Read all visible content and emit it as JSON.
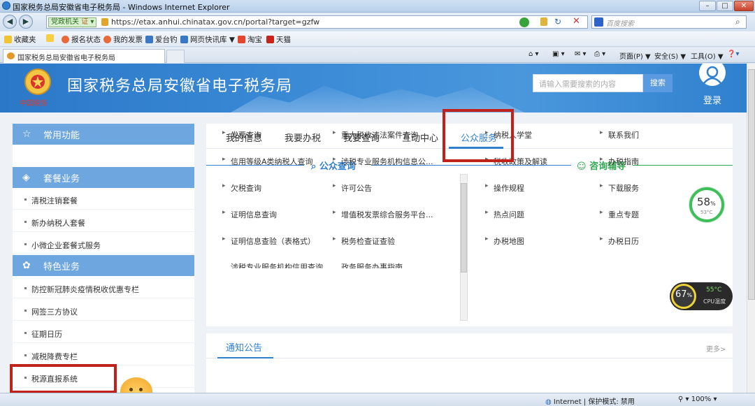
{
  "window": {
    "title": "国家税务总局安徽省电子税务局 - Windows Internet Explorer"
  },
  "addressbar": {
    "site_tag": "党政机关",
    "cert_tag": "证",
    "url": "https://etax.anhui.chinatax.gov.cn/portal?target=gzfw",
    "search_placeholder": "百度搜索"
  },
  "favorites": {
    "label": "收藏夹",
    "items": [
      "报名状态",
      "我的发票",
      "爱台钓",
      "网页快讯库 ▼",
      "淘宝",
      "天猫"
    ]
  },
  "tabbar": {
    "tab_title": "国家税务总局安徽省电子税务局",
    "tools": [
      "页面(P) ▼",
      "安全(S) ▼",
      "工具(O) ▼"
    ]
  },
  "header": {
    "emblem_text": "中国税务",
    "site_title": "国家税务总局安徽省电子税务局",
    "search_placeholder": "请输入需要搜索的内容",
    "search_button": "搜索",
    "login": "登录"
  },
  "sidebar": {
    "section1": "常用功能",
    "section2": "套餐业务",
    "section2_items": [
      "清税注销套餐",
      "新办纳税人套餐",
      "小微企业套餐式服务"
    ],
    "section3": "特色业务",
    "section3_items": [
      "防控新冠肺炎疫情税收优惠专栏",
      "网签三方协议",
      "征期日历",
      "减税降费专栏",
      "税源直报系统"
    ]
  },
  "main": {
    "tabs": [
      "我的信息",
      "我要办税",
      "我要查询",
      "互动中心",
      "公众服务"
    ],
    "active_tab": "公众服务",
    "public_query": {
      "title": "公众查询",
      "col1": [
        "发票查询",
        "信用等级A类纳税人查询",
        "欠税查询",
        "证明信息查询",
        "证明信息查验（表格式）",
        "涉税专业服务机构信用查询"
      ],
      "col2": [
        "重大税收违法案件查询",
        "涉税专业服务机构信息公...",
        "许可公告",
        "增值税发票综合服务平台...",
        "税务检查证查验",
        "政务服务办事指南"
      ]
    },
    "consult": {
      "title": "咨询辅导",
      "col1": [
        "纳税人学堂",
        "税收政策及解读",
        "操作规程",
        "热点问题",
        "办税地图"
      ],
      "col2": [
        "联系我们",
        "办税指南",
        "下载服务",
        "重点专题",
        "办税日历"
      ]
    }
  },
  "notice": {
    "title": "通知公告",
    "more": "更多>"
  },
  "widgets": {
    "mem_percent": "58",
    "mem_unit": "%",
    "mem_temp": "53°C",
    "cpu_percent": "67",
    "cpu_unit": "%",
    "cpu_temp": "55°C",
    "cpu_label": "CPU温度"
  },
  "statusbar": {
    "zone": "Internet | 保护模式: 禁用",
    "zoom": "100%"
  },
  "colors": {
    "accent": "#2f7fd0",
    "highlight": "#c0221b",
    "sidebar_header": "#6ea6e0",
    "consult_green": "#2fa84f"
  }
}
